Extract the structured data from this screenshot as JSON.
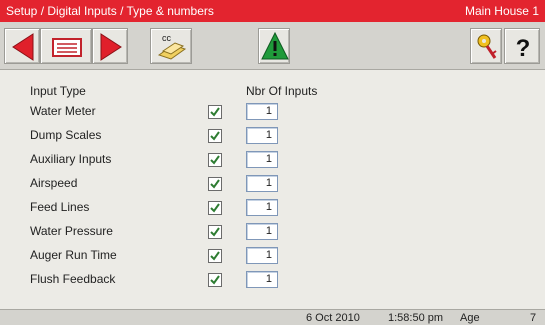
{
  "title_bar": {
    "breadcrumb": "Setup / Digital Inputs / Type & numbers",
    "location": "Main House 1"
  },
  "toolbar": {
    "prev_icon": "left-arrow-icon",
    "menu_icon": "list-icon",
    "next_icon": "right-arrow-icon",
    "copy_icon": "cc-copy-icon",
    "copy_icon_text": "cc",
    "alarm_icon": "warning-icon",
    "key_icon": "key-icon",
    "help_icon": "help-icon",
    "help_text": "?"
  },
  "table": {
    "headers": {
      "input_type": "Input Type",
      "nbr_of_inputs": "Nbr Of Inputs"
    },
    "rows": [
      {
        "label": "Water Meter",
        "enabled": true,
        "count": "1"
      },
      {
        "label": "Dump Scales",
        "enabled": true,
        "count": "1"
      },
      {
        "label": "Auxiliary Inputs",
        "enabled": true,
        "count": "1"
      },
      {
        "label": "Airspeed",
        "enabled": true,
        "count": "1"
      },
      {
        "label": "Feed Lines",
        "enabled": true,
        "count": "1"
      },
      {
        "label": "Water Pressure",
        "enabled": true,
        "count": "1"
      },
      {
        "label": "Auger Run Time",
        "enabled": true,
        "count": "1"
      },
      {
        "label": "Flush Feedback",
        "enabled": true,
        "count": "1"
      }
    ]
  },
  "status_bar": {
    "date": "6 Oct 2010",
    "time": "1:58:50 pm",
    "age_label": "Age",
    "age_value": "7"
  },
  "colors": {
    "title_bar": "#e3242f",
    "arrow_red": "#e0202b",
    "warning_green": "#1f9a3a",
    "check_green": "#2e7d32"
  }
}
